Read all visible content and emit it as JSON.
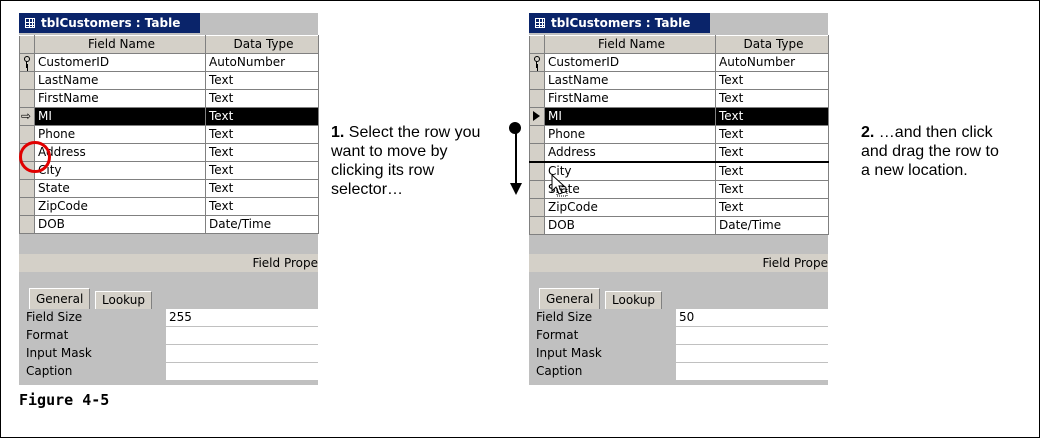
{
  "left_window": {
    "title": "tblCustomers : Table",
    "headers": {
      "field_name": "Field Name",
      "data_type": "Data Type"
    },
    "rows": [
      {
        "field": "CustomerID",
        "type": "AutoNumber"
      },
      {
        "field": "LastName",
        "type": "Text"
      },
      {
        "field": "FirstName",
        "type": "Text"
      },
      {
        "field": "MI",
        "type": "Text"
      },
      {
        "field": "Phone",
        "type": "Text"
      },
      {
        "field": "Address",
        "type": "Text"
      },
      {
        "field": "City",
        "type": "Text"
      },
      {
        "field": "State",
        "type": "Text"
      },
      {
        "field": "ZipCode",
        "type": "Text"
      },
      {
        "field": "DOB",
        "type": "Date/Time"
      }
    ],
    "field_properties": "Field Prope",
    "tabs": {
      "general": "General",
      "lookup": "Lookup"
    },
    "props": [
      {
        "label": "Field Size",
        "value": "255"
      },
      {
        "label": "Format",
        "value": ""
      },
      {
        "label": "Input Mask",
        "value": ""
      },
      {
        "label": "Caption",
        "value": ""
      }
    ]
  },
  "right_window": {
    "title": "tblCustomers : Table",
    "headers": {
      "field_name": "Field Name",
      "data_type": "Data Type"
    },
    "rows": [
      {
        "field": "CustomerID",
        "type": "AutoNumber"
      },
      {
        "field": "LastName",
        "type": "Text"
      },
      {
        "field": "FirstName",
        "type": "Text"
      },
      {
        "field": "MI",
        "type": "Text"
      },
      {
        "field": "Phone",
        "type": "Text"
      },
      {
        "field": "Address",
        "type": "Text"
      },
      {
        "field": "City",
        "type": "Text"
      },
      {
        "field": "State",
        "type": "Text"
      },
      {
        "field": "ZipCode",
        "type": "Text"
      },
      {
        "field": "DOB",
        "type": "Date/Time"
      }
    ],
    "field_properties": "Field Prope",
    "tabs": {
      "general": "General",
      "lookup": "Lookup"
    },
    "props": [
      {
        "label": "Field Size",
        "value": "50"
      },
      {
        "label": "Format",
        "value": ""
      },
      {
        "label": "Input Mask",
        "value": ""
      },
      {
        "label": "Caption",
        "value": ""
      }
    ]
  },
  "captions": {
    "step1_num": "1.",
    "step1_text": "Select the row you want to move by clicking its row selector…",
    "step2_num": "2.",
    "step2_text": "…and then click and drag the row to a new location."
  },
  "figure_label": "Figure 4-5",
  "icons": {
    "table": "table-icon",
    "primary_key": "key-icon",
    "current_row": "row-arrow-icon",
    "move_row": "move-arrow-icon",
    "drag": "drag-arrow-icon",
    "cursor": "pointer-cursor-icon"
  },
  "colors": {
    "highlight": "#e00000",
    "titlebar": "#0a246a",
    "selected_row": "#000000"
  }
}
